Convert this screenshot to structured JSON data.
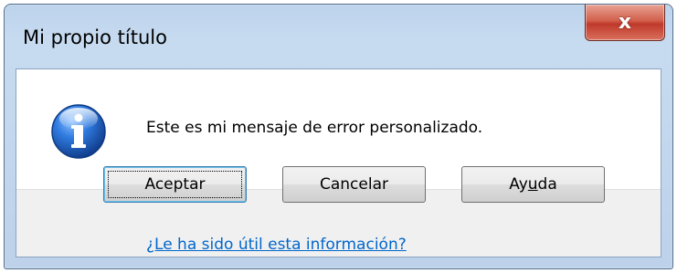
{
  "window": {
    "title": "Mi propio título",
    "close_glyph": "x"
  },
  "dialog": {
    "icon": "information-icon",
    "message": "Este es mi mensaje de error personalizado."
  },
  "buttons": {
    "accept": "Aceptar",
    "cancel": "Cancelar",
    "help_prefix": "Ay",
    "help_accel": "u",
    "help_suffix": "da"
  },
  "footer": {
    "link": "¿Le ha sido útil esta información?"
  },
  "colors": {
    "link": "#0066cc",
    "icon_blue": "#1d5fbf",
    "close_red": "#c0392b"
  }
}
